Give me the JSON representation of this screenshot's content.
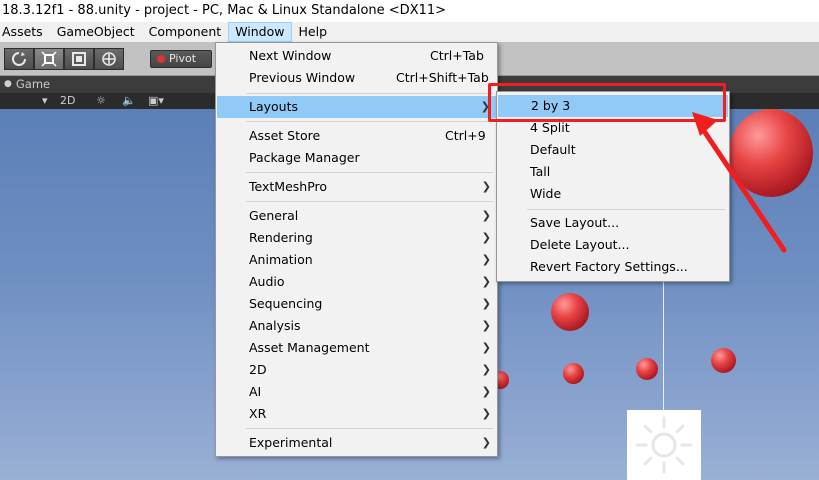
{
  "window": {
    "title": "18.3.12f1 - 88.unity - project - PC, Mac & Linux Standalone <DX11>"
  },
  "menubar": {
    "items": [
      {
        "label": "Assets"
      },
      {
        "label": "GameObject"
      },
      {
        "label": "Component"
      },
      {
        "label": "Window"
      },
      {
        "label": "Help"
      }
    ],
    "active": "Window"
  },
  "toolbar": {
    "pivot_label": "Pivot"
  },
  "game_view": {
    "tab_label": "Game",
    "mode_2d": "2D"
  },
  "window_menu": {
    "items": [
      {
        "label": "Next Window",
        "shortcut": "Ctrl+Tab"
      },
      {
        "label": "Previous Window",
        "shortcut": "Ctrl+Shift+Tab"
      },
      {
        "label": "Layouts",
        "submenu": true,
        "highlighted": true
      },
      {
        "label": "Asset Store",
        "shortcut": "Ctrl+9"
      },
      {
        "label": "Package Manager"
      },
      {
        "label": "TextMeshPro",
        "submenu": true
      },
      {
        "label": "General",
        "submenu": true
      },
      {
        "label": "Rendering",
        "submenu": true
      },
      {
        "label": "Animation",
        "submenu": true
      },
      {
        "label": "Audio",
        "submenu": true
      },
      {
        "label": "Sequencing",
        "submenu": true
      },
      {
        "label": "Analysis",
        "submenu": true
      },
      {
        "label": "Asset Management",
        "submenu": true
      },
      {
        "label": "2D",
        "submenu": true
      },
      {
        "label": "AI",
        "submenu": true
      },
      {
        "label": "XR",
        "submenu": true
      },
      {
        "label": "Experimental",
        "submenu": true
      }
    ]
  },
  "layouts_submenu": {
    "items": [
      {
        "label": "2 by 3",
        "highlighted": true
      },
      {
        "label": "4 Split"
      },
      {
        "label": "Default"
      },
      {
        "label": "Tall"
      },
      {
        "label": "Wide"
      },
      {
        "label": "Save Layout..."
      },
      {
        "label": "Delete Layout..."
      },
      {
        "label": "Revert Factory Settings..."
      }
    ]
  },
  "colors": {
    "highlight": "#91c9f7",
    "annotation": "#f01e1e",
    "sky": "#6f8fc2",
    "ball": "#e84545"
  },
  "icons": {
    "submenu_arrow": "chevron-right-icon",
    "annotation_arrow": "red-arrow-icon",
    "directional_light": "sun-icon"
  }
}
